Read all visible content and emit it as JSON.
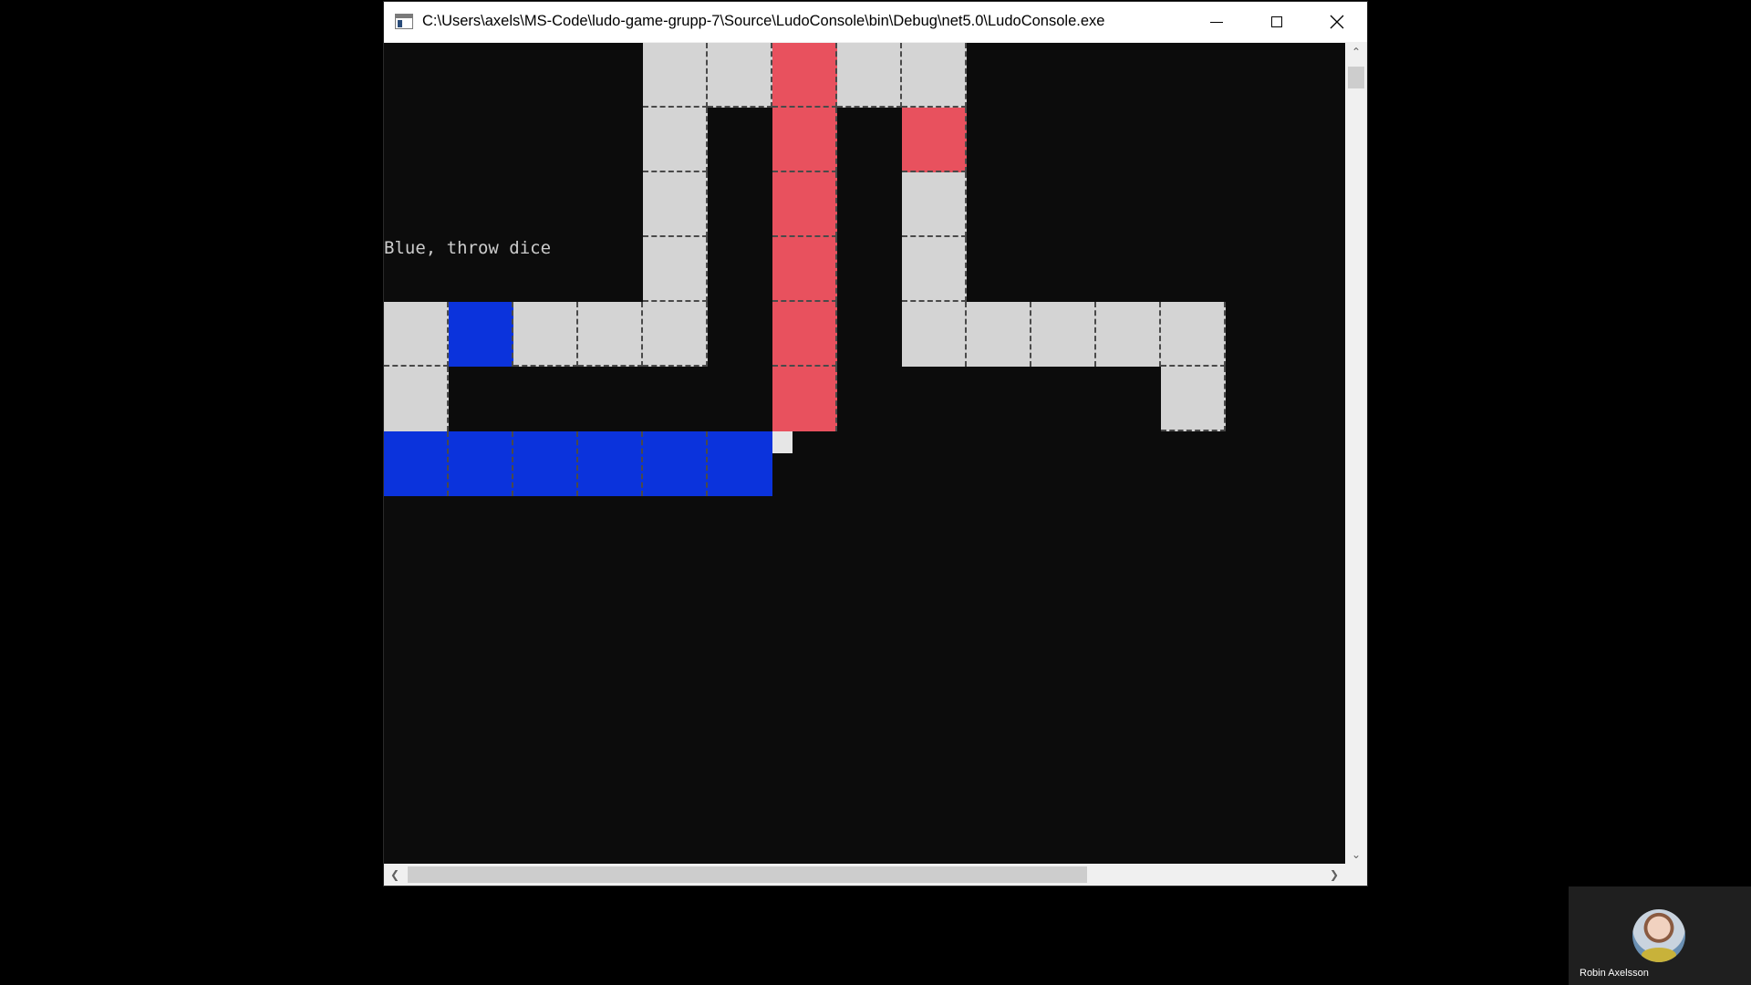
{
  "window": {
    "title": "C:\\Users\\axels\\MS-Code\\ludo-game-grupp-7\\Source\\LudoConsole\\bin\\Debug\\net5.0\\LudoConsole.exe",
    "icon": "console-app-icon",
    "controls": {
      "minimize_icon": "minimize-icon",
      "maximize_icon": "maximize-icon",
      "close_icon": "close-icon"
    }
  },
  "console": {
    "background_color": "#0c0c0c",
    "text_color": "#cccccc",
    "message": "Blue, throw dice",
    "board_colors": {
      "track": "#d4d4d4",
      "red": "#e8515e",
      "blue": "#0b33dc"
    }
  },
  "call": {
    "participant_name": "Robin Axelsson",
    "avatar": "user-avatar"
  }
}
